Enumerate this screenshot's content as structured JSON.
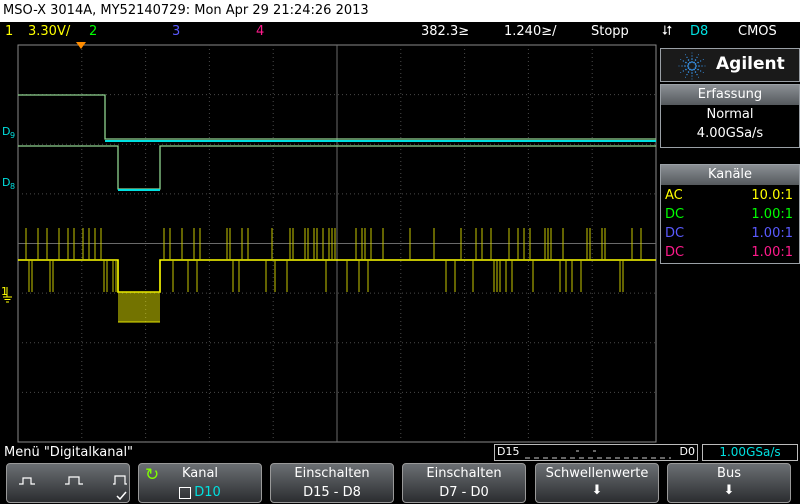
{
  "title": "MSO-X 3014A, MY52140729: Mon Apr 29 21:24:26 2013",
  "status": {
    "ch1_num": "1",
    "ch1_scale": "3.30V/",
    "ch2_num": "2",
    "ch3_num": "3",
    "ch4_num": "4",
    "timebase_pos": "382.3≥",
    "timebase_div": "1.240≥/",
    "run_state": "Stopp",
    "trigger_source": "D8",
    "trigger_type": "CMOS"
  },
  "markers": {
    "d9": "D9",
    "d8": "D8",
    "ch1": "1"
  },
  "brand": "Agilent",
  "acquisition": {
    "header": "Erfassung",
    "mode": "Normal",
    "rate": "4.00GSa/s"
  },
  "channels": {
    "header": "Kanäle",
    "rows": [
      {
        "coupling": "AC",
        "probe": "10.0:1",
        "color": "#ffff00"
      },
      {
        "coupling": "DC",
        "probe": "1.00:1",
        "color": "#00ff00"
      },
      {
        "coupling": "DC",
        "probe": "1.00:1",
        "color": "#5a5aff"
      },
      {
        "coupling": "DC",
        "probe": "1.00:1",
        "color": "#ff1a8c"
      }
    ]
  },
  "menu_title": "Menü \"Digitalkanal\"",
  "bus_overview": {
    "left": "D15",
    "right": "D0",
    "rate": "1.00GSa/s"
  },
  "softkeys": [
    {
      "line1": "",
      "line2": ""
    },
    {
      "line1": "Kanal",
      "line2": "D10"
    },
    {
      "line1": "Einschalten",
      "line2": "D15 - D8"
    },
    {
      "line1": "Einschalten",
      "line2": "D7 - D0"
    },
    {
      "line1": "Schwellenwerte",
      "line2": ""
    },
    {
      "line1": "Bus",
      "line2": ""
    }
  ],
  "colors": {
    "ch1": "#ffff00",
    "ch2": "#00ff00",
    "ch3": "#5a5aff",
    "ch4": "#ff1a8c",
    "digital": "#00e0e0"
  }
}
